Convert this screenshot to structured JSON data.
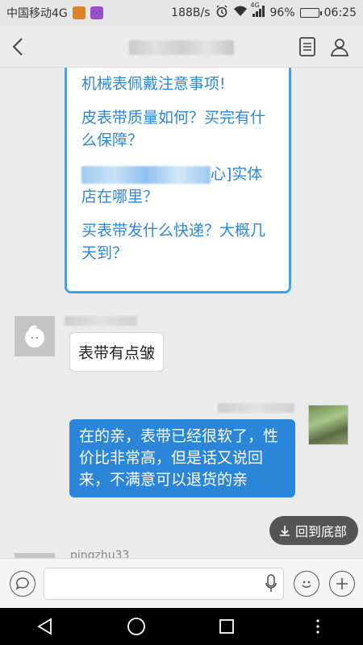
{
  "status_bar": {
    "carrier": "中国移动4G",
    "speed": "188B/s",
    "network_label": "4G",
    "battery": "96%",
    "battery_level": 0.96,
    "time": "06:25"
  },
  "card": {
    "lines": [
      "机械表佩戴注意事项!",
      "皮表带质量如何？买完有什么保障？",
      "心]实体店在哪里？",
      "买表带发什么快递？大概几天到？"
    ]
  },
  "messages": [
    {
      "direction": "incoming",
      "text": "表带有点皱"
    },
    {
      "direction": "outgoing",
      "text": "在的亲，表带已经很软了，性价比非常高，但是话又说回来，不满意可以退货的亲"
    }
  ],
  "back_to_bottom": "回到底部",
  "partial_sender": "pingzhu33",
  "colors": {
    "accent": "#2b86da",
    "card_border": "#3fa3e8",
    "card_text": "#2f86d8"
  }
}
